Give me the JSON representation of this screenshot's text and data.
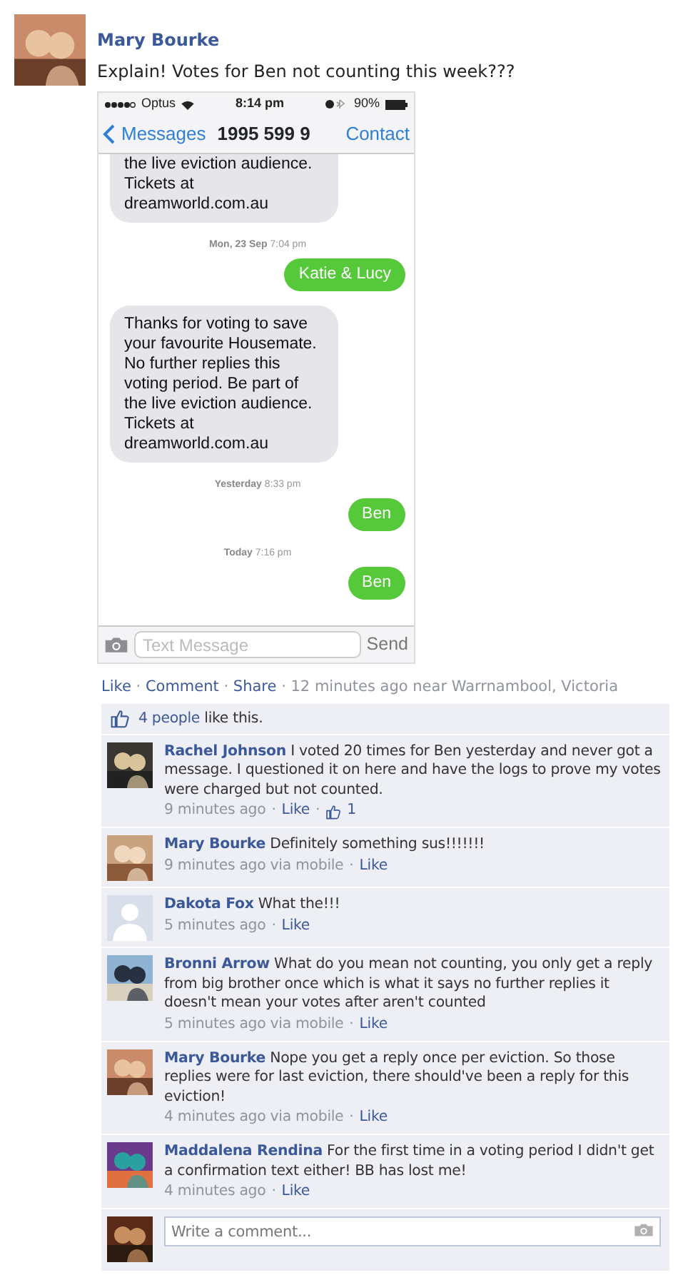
{
  "separator": "·",
  "post": {
    "author": "Mary Bourke",
    "text": "Explain! Votes for Ben not counting this week???",
    "screenshot": {
      "status": {
        "carrier": "Optus",
        "time": "8:14 pm",
        "battery": "90%"
      },
      "nav": {
        "back": "Messages",
        "title": "1995 599 9",
        "action": "Contact"
      },
      "messages": [
        {
          "kind": "received",
          "cut": true,
          "lines": [
            "the live eviction audience.",
            "Tickets at"
          ],
          "link": "dreamworld.com.au"
        },
        {
          "kind": "timestamp",
          "day": "Mon, 23 Sep",
          "time": "7:04 pm"
        },
        {
          "kind": "sent",
          "text": "Katie & Lucy"
        },
        {
          "kind": "received",
          "cut": false,
          "lines": [
            "Thanks for voting to save",
            "your favourite Housemate.",
            "No further replies this",
            "voting period. Be part of",
            "the live eviction audience.",
            "Tickets at"
          ],
          "link": "dreamworld.com.au"
        },
        {
          "kind": "timestamp",
          "day": "Yesterday",
          "time": "8:33 pm"
        },
        {
          "kind": "sent",
          "text": "Ben"
        },
        {
          "kind": "timestamp",
          "day": "Today",
          "time": "7:16 pm"
        },
        {
          "kind": "sent",
          "text": "Ben"
        }
      ],
      "input": {
        "placeholder": "Text Message",
        "send": "Send"
      }
    },
    "actions": [
      "Like",
      "Comment",
      "Share"
    ],
    "meta": "12 minutes ago near Warrnambool, Victoria"
  },
  "likes": {
    "people": "4 people",
    "text": "like this."
  },
  "comments": [
    {
      "author": "Rachel Johnson",
      "text": "I voted 20 times for Ben yesterday and never got a message. I questioned it on here and have the logs to prove my votes were charged but not counted.",
      "time": "9 minutes ago",
      "like": "Like",
      "like_count": "1"
    },
    {
      "author": "Mary Bourke",
      "text": "Definitely something sus!!!!!!!",
      "time": "9 minutes ago via mobile",
      "like": "Like"
    },
    {
      "author": "Dakota Fox",
      "avatar": {
        "kind": "silhouette"
      },
      "text": "What the!!!",
      "time": "5 minutes ago",
      "like": "Like"
    },
    {
      "author": "Bronni Arrow",
      "text": "What do you mean not counting, you only get a reply from big brother once which is what it says no further replies it doesn't mean your votes after aren't counted",
      "time": "5 minutes ago via mobile",
      "like": "Like"
    },
    {
      "author": "Mary Bourke",
      "text": "Nope you get a reply once per eviction. So those replies were for last eviction, there should've been a reply for this eviction!",
      "time": "4 minutes ago via mobile",
      "like": "Like"
    },
    {
      "author": "Maddalena Rendina",
      "text": "For the first time in a voting period I didn't get a confirmation text either! BB has lost me!",
      "time": "4 minutes ago",
      "like": "Like"
    }
  ],
  "comment_box": {
    "placeholder": "Write a comment..."
  }
}
